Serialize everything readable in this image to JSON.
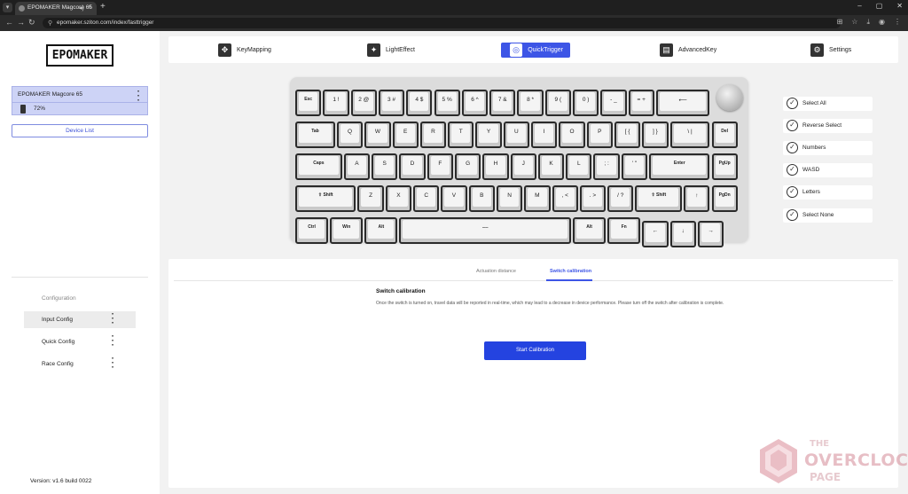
{
  "browser": {
    "tab_title": "EPOMAKER Magcore 65",
    "tab_audio_icon": "speaker-icon",
    "tab_close": "×",
    "new_tab": "+",
    "url": "epomaker.sziton.com/index/fasttrigger",
    "win_controls": [
      "–",
      "▢",
      "✕"
    ]
  },
  "sidebar": {
    "logo": "EPOMAKER",
    "device": {
      "name": "EPOMAKER Magcore 65",
      "battery": "72%"
    },
    "device_list_label": "Device List",
    "config_heading": "Configuration",
    "config_items": [
      {
        "label": "Input Config",
        "active": true
      },
      {
        "label": "Quick Config",
        "active": false
      },
      {
        "label": "Race Config",
        "active": false
      }
    ],
    "version": "Version: v1.6 build 0022"
  },
  "topnav": [
    {
      "label": "KeyMapping",
      "icon": "keymapping-icon"
    },
    {
      "label": "LightEffect",
      "icon": "sparkle-icon"
    },
    {
      "label": "QuickTrigger",
      "icon": "quicktrigger-icon",
      "active": true
    },
    {
      "label": "AdvancedKey",
      "icon": "keyboard-icon"
    },
    {
      "label": "Settings",
      "icon": "gear-icon"
    }
  ],
  "keyboard": {
    "rows": [
      [
        "Esc",
        "1 !",
        "2 @",
        "3 #",
        "4 $",
        "5 %",
        "6 ^",
        "7 &",
        "8 *",
        "9 (",
        "0 )",
        "- _",
        "= +",
        "⟵"
      ],
      [
        "Tab",
        "Q",
        "W",
        "E",
        "R",
        "T",
        "Y",
        "U",
        "I",
        "O",
        "P",
        "[ {",
        "] }",
        "\\ |",
        "Del"
      ],
      [
        "Caps",
        "A",
        "S",
        "D",
        "F",
        "G",
        "H",
        "J",
        "K",
        "L",
        "; :",
        "' \"",
        "Enter",
        "PgUp"
      ],
      [
        "⇧ Shift",
        "Z",
        "X",
        "C",
        "V",
        "B",
        "N",
        "M",
        ", <",
        ". >",
        "/ ?",
        "⇧ Shift",
        "↑",
        "PgDn"
      ],
      [
        "Ctrl",
        "Win",
        "Alt",
        "⎯⎯",
        "Alt",
        "Fn",
        "←",
        "↓",
        "→"
      ]
    ]
  },
  "selection": [
    {
      "label": "Select All"
    },
    {
      "label": "Reverse Select"
    },
    {
      "label": "Numbers"
    },
    {
      "label": "WASD"
    },
    {
      "label": "Letters"
    },
    {
      "label": "Select None"
    }
  ],
  "panel": {
    "tabs": [
      {
        "label": "Actuation distance",
        "active": false
      },
      {
        "label": "Switch calibration",
        "active": true
      }
    ],
    "title": "Switch calibration",
    "description": "Once the switch is turned on, travel data will be reported in real-time, which may lead to a decrease in device performance. Please turn off the switch after calibration is complete.",
    "button": "Start Calibration"
  },
  "watermark": {
    "line1": "THE",
    "line2": "OVERCLOCK",
    "line3": "PAGE"
  },
  "colors": {
    "accent": "#3d55e6",
    "button": "#2443e0",
    "device_card": "#cdd3f6"
  }
}
